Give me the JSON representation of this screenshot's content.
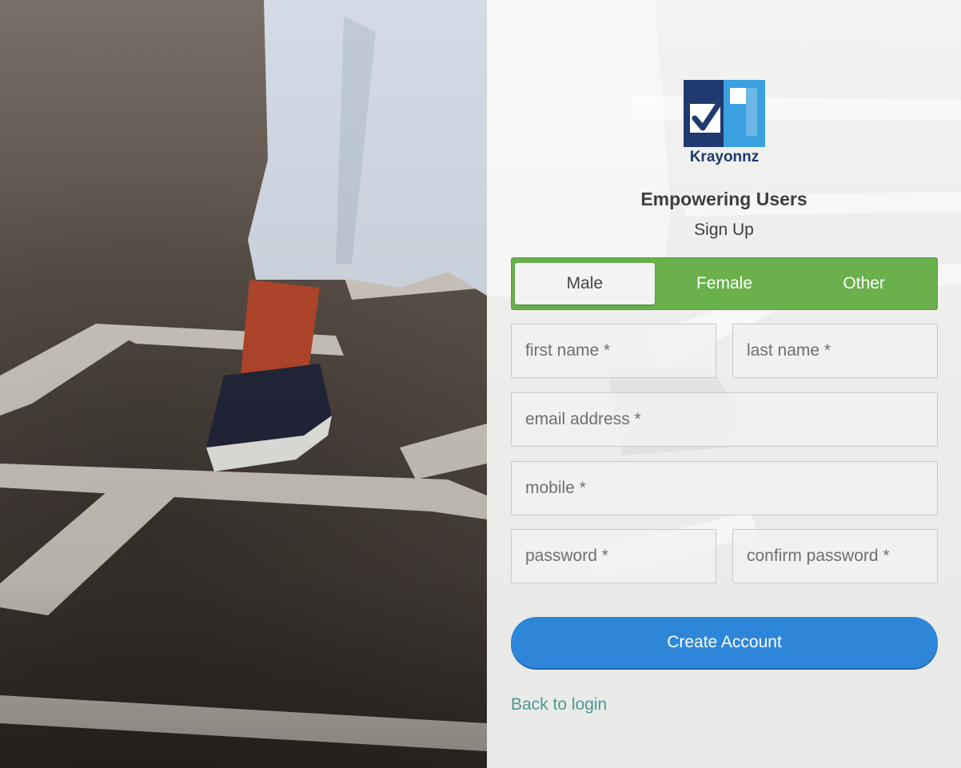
{
  "brand": {
    "name": "Krayonnz",
    "logo_icon": "checkmark-logo-icon"
  },
  "tagline": "Empowering Users",
  "subtitle": "Sign Up",
  "gender": {
    "options": [
      "Male",
      "Female",
      "Other"
    ],
    "selected": "Male"
  },
  "form": {
    "first_name_placeholder": "first name *",
    "last_name_placeholder": "last name *",
    "email_placeholder": "email address *",
    "mobile_placeholder": "mobile *",
    "password_placeholder": "password *",
    "confirm_password_placeholder": "confirm password *"
  },
  "actions": {
    "create_account_label": "Create Account",
    "back_to_login_label": "Back to login"
  },
  "colors": {
    "gender_bar": "#6ab04c",
    "primary_button": "#2e86d9",
    "link": "#4a9a94",
    "brand_navy": "#1f3a6e",
    "brand_blue": "#3aa0e0"
  }
}
